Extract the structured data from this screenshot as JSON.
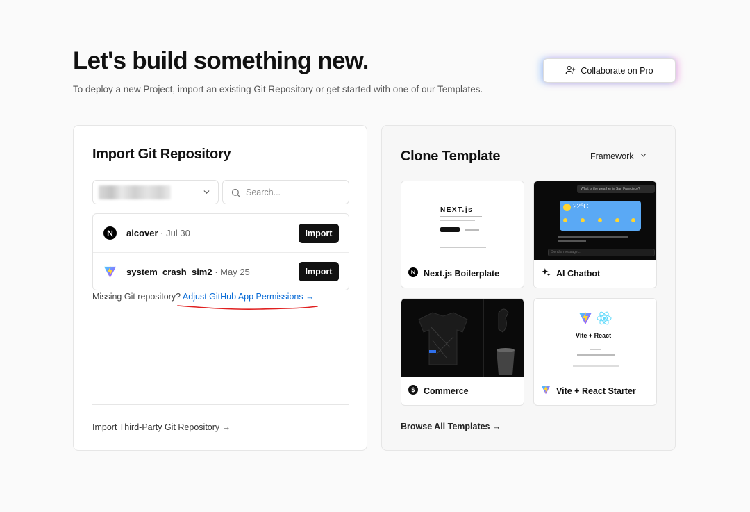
{
  "header": {
    "title": "Let's build something new.",
    "subtitle": "To deploy a new Project, import an existing Git Repository or get started with one of our Templates.",
    "collaborate_label": "Collaborate on Pro"
  },
  "import_card": {
    "title": "Import Git Repository",
    "search_placeholder": "Search...",
    "repos": [
      {
        "name": "aicover",
        "date": "· Jul 30",
        "icon": "nextjs-icon",
        "action": "Import"
      },
      {
        "name": "system_crash_sim2",
        "date": "· May 25",
        "icon": "vite-icon",
        "action": "Import"
      }
    ],
    "missing_text": "Missing Git repository?",
    "adjust_link": "Adjust GitHub App Permissions →",
    "third_party_link": "Import Third-Party Git Repository →"
  },
  "clone_card": {
    "title": "Clone Template",
    "framework_label": "Framework",
    "templates": [
      {
        "name": "Next.js Boilerplate",
        "icon": "nextjs-icon"
      },
      {
        "name": "AI Chatbot",
        "icon": "sparkle-icon"
      },
      {
        "name": "Commerce",
        "icon": "dollar-icon"
      },
      {
        "name": "Vite + React Starter",
        "icon": "vite-icon"
      }
    ],
    "browse_all": "Browse All Templates →",
    "previews": {
      "next_logo": "NEXT.js",
      "chatbot_question": "What is the weather in San Francisco?",
      "chatbot_temp": "22°C",
      "chatbot_input": "Send a message...",
      "vite_title": "Vite + React"
    }
  },
  "colors": {
    "link": "#0a6cd6",
    "button_dark": "#111111",
    "annotation_red": "#e02020"
  }
}
